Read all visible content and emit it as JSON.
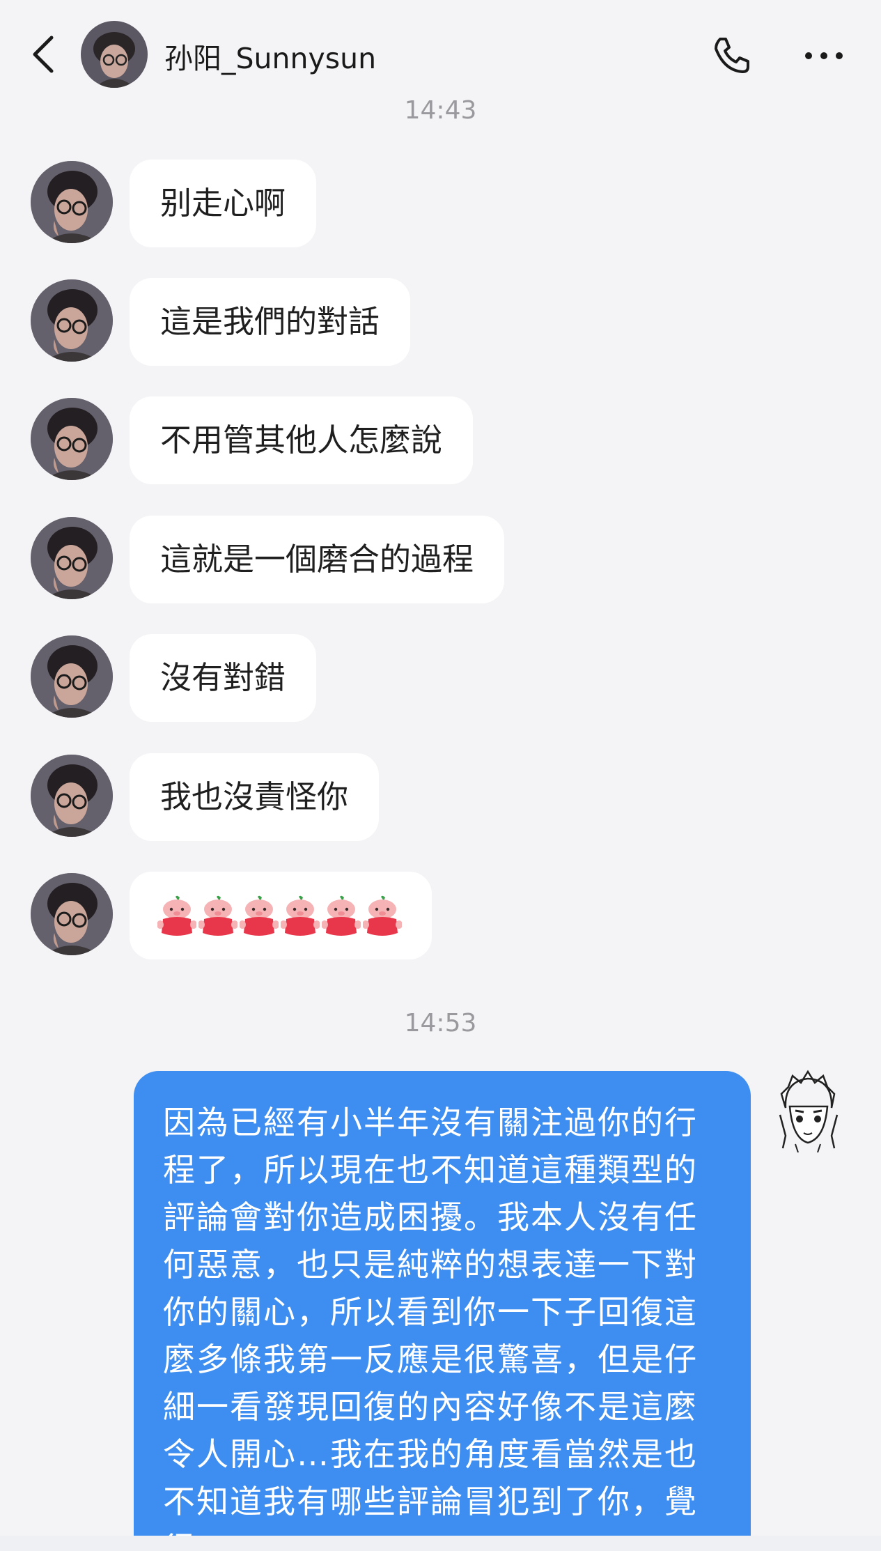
{
  "header": {
    "title": "孙阳_Sunnysun"
  },
  "chat": {
    "timestamps": [
      "14:43",
      "14:53"
    ],
    "received": [
      "别走心啊",
      "這是我們的對話",
      "不用管其他人怎麼說",
      "這就是一個磨合的過程",
      "沒有對錯",
      "我也沒責怪你"
    ],
    "emoji_message": {
      "icon": "pig-emoji-icon",
      "count": 6
    },
    "sent": "因為已經有小半年沒有關注過你的行程了，所以現在也不知道這種類型的評論會對你造成困擾。我本人沒有任何惡意，也只是純粹的想表達一下對你的關心，所以看到你一下子回復這麼多條我第一反應是很驚喜，但是仔細一看發現回復的內容好像不是這麼令人開心…我在我的角度看當然是也不知道我有哪些評論冒犯到了你，覺得"
  },
  "colors": {
    "background": "#f4f4f6",
    "received_bubble": "#ffffff",
    "sent_bubble": "#3d8ef0",
    "timestamp_text": "#9a9a9e"
  }
}
